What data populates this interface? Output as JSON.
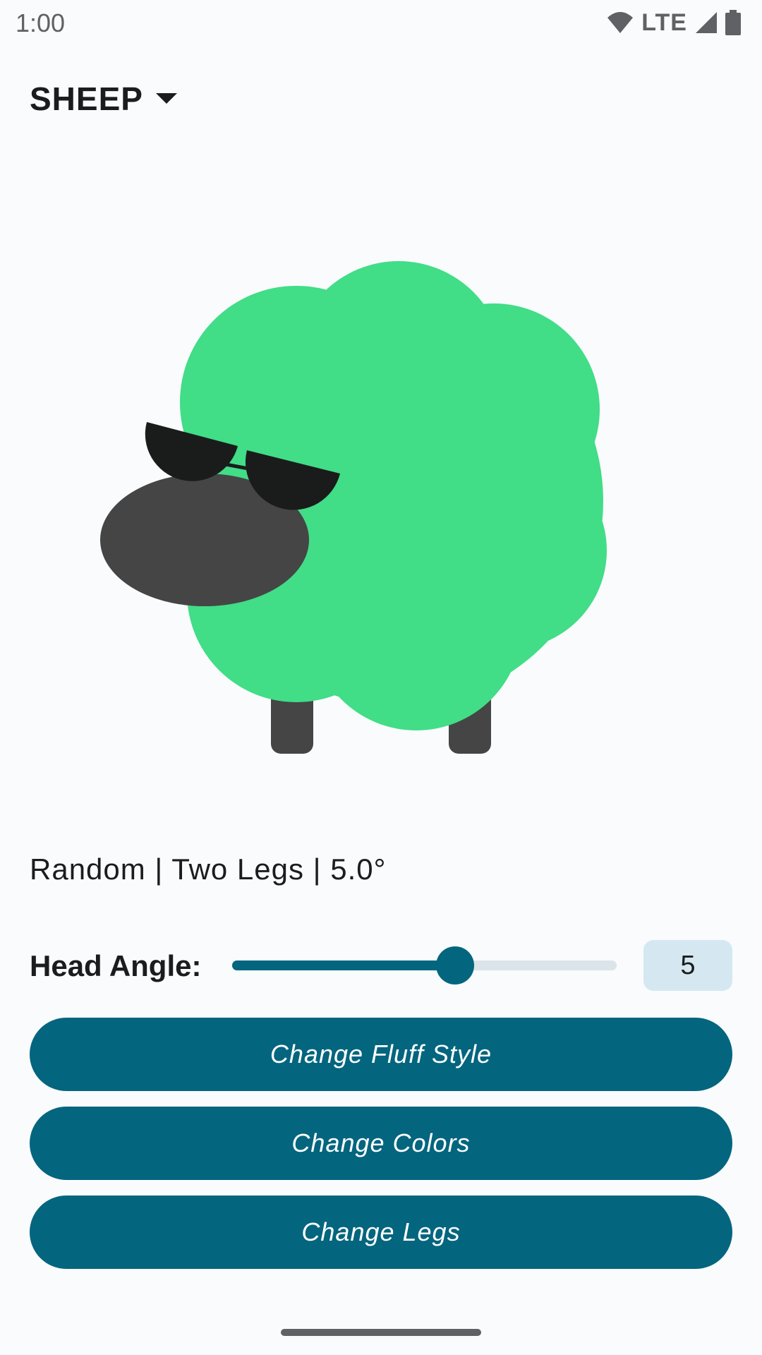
{
  "status_bar": {
    "time": "1:00",
    "network_label": "LTE",
    "icons": [
      "wifi-icon",
      "cellular-signal-icon",
      "battery-icon"
    ]
  },
  "header": {
    "title": "SHEEP",
    "dropdown_icon": "dropdown-arrow-icon"
  },
  "sheep": {
    "fluff_color": "#41dd87",
    "head_color": "#454545",
    "legs_color": "#454545",
    "glasses_color": "#1a1c1c"
  },
  "settings_summary": "Random | Two Legs | 5.0°",
  "head_angle": {
    "label": "Head Angle:",
    "value": "5",
    "slider_fraction": 0.58
  },
  "buttons": {
    "fluff_style": "Change Fluff Style",
    "colors": "Change Colors",
    "legs": "Change Legs"
  },
  "colors": {
    "primary": "#04657e",
    "background": "#f9fbfd",
    "value_box": "#d5e8f2"
  }
}
